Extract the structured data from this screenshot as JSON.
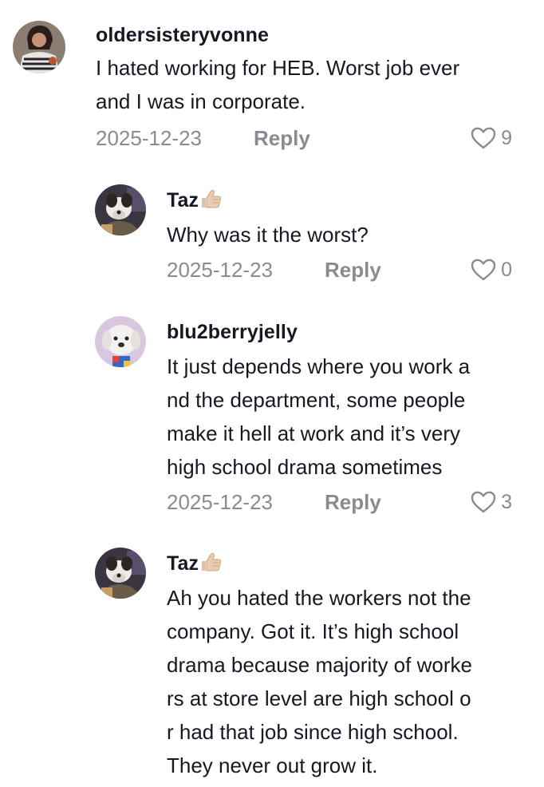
{
  "comments": [
    {
      "username": "oldersisteryvonne",
      "emoji": "",
      "text": "I hated working for HEB. Worst job ever\nand I was in corporate.",
      "date": "2025-12-23",
      "reply_label": "Reply",
      "likes": "9"
    },
    {
      "username": "Taz",
      "emoji": "thumbs-up-emoji",
      "text": "Why was it the worst?",
      "date": "2025-12-23",
      "reply_label": "Reply",
      "likes": "0"
    },
    {
      "username": "blu2berryjelly",
      "emoji": "",
      "text": "It just depends where you work a\nnd the department, some people\nmake it hell at work and it’s very\nhigh school drama sometimes",
      "date": "2025-12-23",
      "reply_label": "Reply",
      "likes": "3"
    },
    {
      "username": "Taz",
      "emoji": "thumbs-up-emoji",
      "text": "Ah you hated the workers not the\ncompany. Got it. It’s high school\ndrama because majority of worke\nrs at store level are high school o\nr had that job since high school.\nThey never out grow it.",
      "date": "",
      "reply_label": "",
      "likes": ""
    }
  ]
}
